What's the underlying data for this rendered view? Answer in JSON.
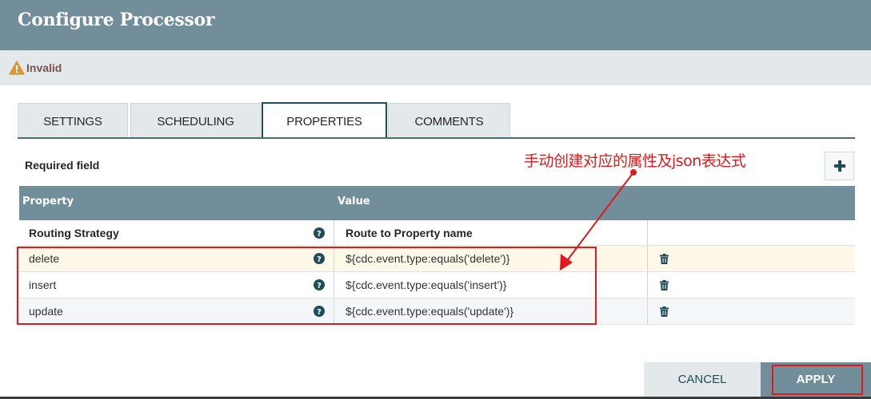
{
  "dialog": {
    "title": "Configure Processor",
    "status": "Invalid",
    "status_icon": "warning-triangle-icon"
  },
  "tabs": [
    {
      "label": "SETTINGS",
      "active": false
    },
    {
      "label": "SCHEDULING",
      "active": false
    },
    {
      "label": "PROPERTIES",
      "active": true
    },
    {
      "label": "COMMENTS",
      "active": false
    }
  ],
  "properties": {
    "required_label": "Required field",
    "add_button_icon": "plus-icon",
    "annotation": "手动创建对应的属性及json表达式",
    "columns": [
      "Property",
      "Value"
    ],
    "rows": [
      {
        "name": "Routing Strategy",
        "value": "Route to Property name",
        "required": true,
        "deletable": false
      },
      {
        "name": "delete",
        "value": "${cdc.event.type:equals('delete')}",
        "required": false,
        "deletable": true
      },
      {
        "name": "insert",
        "value": "${cdc.event.type:equals('insert')}",
        "required": false,
        "deletable": true
      },
      {
        "name": "update",
        "value": "${cdc.event.type:equals('update')}",
        "required": false,
        "deletable": true
      }
    ]
  },
  "footer": {
    "cancel_label": "CANCEL",
    "apply_label": "APPLY"
  },
  "colors": {
    "header_bg": "#728e9b",
    "annotation_red": "#e0191d",
    "icon_teal": "#1e4d59",
    "warning": "#d39a3c"
  }
}
